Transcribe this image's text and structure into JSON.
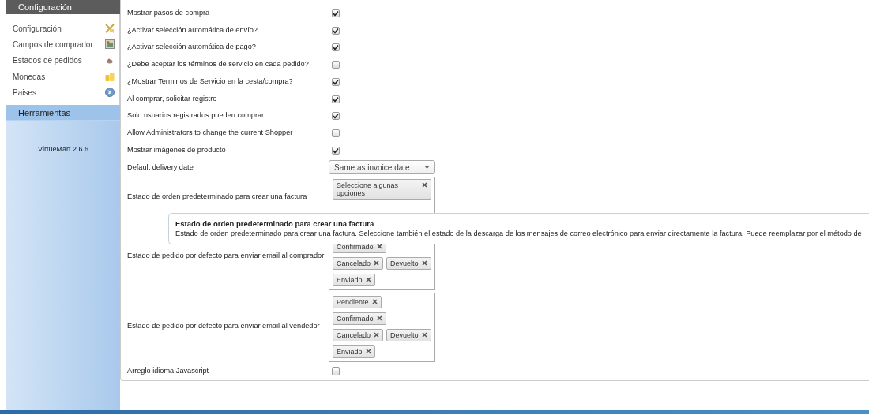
{
  "sidebar": {
    "header": "Configuración",
    "items": [
      {
        "label": "Configuración"
      },
      {
        "label": "Campos de comprador"
      },
      {
        "label": "Estados de pedidos"
      },
      {
        "label": "Monedas"
      },
      {
        "label": "Paises"
      }
    ],
    "section": "Herramientas",
    "version": "VirtueMart 2.6.6"
  },
  "settings": [
    {
      "kind": "checkbox",
      "label": "Mostrar pasos de compra",
      "checked": true
    },
    {
      "kind": "checkbox",
      "label": "¿Activar selección automática de envío?",
      "checked": true
    },
    {
      "kind": "checkbox",
      "label": "¿Activar selección automática de pago?",
      "checked": true
    },
    {
      "kind": "checkbox",
      "label": "¿Debe aceptar los términos de servicio en cada pedido?",
      "checked": false
    },
    {
      "kind": "checkbox",
      "label": "¿Mostrar Terminos de Servicio en la cesta/compra?",
      "checked": true
    },
    {
      "kind": "checkbox",
      "label": "Al comprar, solicitar registro",
      "checked": true
    },
    {
      "kind": "checkbox",
      "label": "Solo usuarios registrados pueden comprar",
      "checked": true
    },
    {
      "kind": "checkbox",
      "label": "Allow Administrators to change the current Shopper",
      "checked": false
    },
    {
      "kind": "checkbox",
      "label": "Mostrar imágenes de producto",
      "checked": true
    },
    {
      "kind": "select",
      "label": "Default delivery date",
      "value": "Same as invoice date"
    },
    {
      "kind": "multiselect",
      "label": "Estado de orden predeterminado para crear una factura",
      "chips": [
        "Seleccione algunas opciones"
      ]
    },
    {
      "kind": "multiselect",
      "label": "Estado de pedido por defecto para enviar email al comprador",
      "chips": [
        "Confirmado",
        "Cancelado",
        "Devuelto",
        "Enviado"
      ]
    },
    {
      "kind": "multiselect",
      "label": "Estado de pedido por defecto para enviar email al vendedor",
      "chips": [
        "Pendiente",
        "Confirmado",
        "Cancelado",
        "Devuelto",
        "Enviado"
      ]
    },
    {
      "kind": "checkbox",
      "label": "Arreglo idioma Javascript",
      "checked": false
    }
  ],
  "tooltip": {
    "title": "Estado de orden predeterminado para crear una factura",
    "text": "Estado de orden predeterminado para crear una factura. Seleccione también el estado de la descarga de los mensajes de correo electrónico para enviar directamente la factura. Puede reemplazar por el método de"
  }
}
